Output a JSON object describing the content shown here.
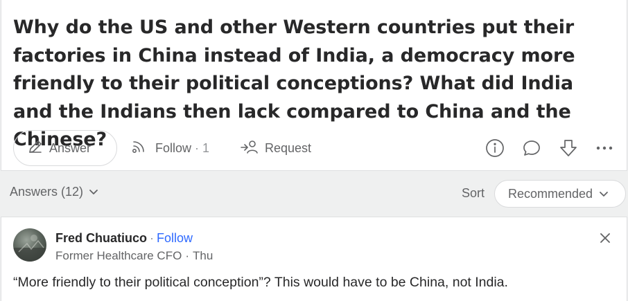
{
  "question": {
    "title": "Why do the US and other Western countries put their factories in China instead of India, a democracy more friendly to their political conceptions? What did India and the Indians then lack compared to China and the Chinese?",
    "actions": {
      "answer_label": "Answer",
      "follow_label": "Follow",
      "follow_separator": "·",
      "follow_count": "1",
      "request_label": "Request"
    },
    "icons": [
      "info-icon",
      "comment-icon",
      "downvote-icon",
      "more-icon"
    ]
  },
  "answers_bar": {
    "count_label": "Answers (12)",
    "sort_label": "Sort",
    "sort_value": "Recommended"
  },
  "answer": {
    "author": {
      "name": "Fred Chuatiuco",
      "separator": "·",
      "follow_label": "Follow",
      "credential": "Former Healthcare CFO",
      "date_separator": "·",
      "date": "Thu"
    },
    "text": "“More friendly to their political conception”? This would have to be China, not India."
  },
  "colors": {
    "background": "#eff0f0",
    "card": "#ffffff",
    "text_primary": "#282829",
    "text_secondary": "#636466",
    "link_blue": "#2e69ff",
    "border": "#dee0e1"
  }
}
